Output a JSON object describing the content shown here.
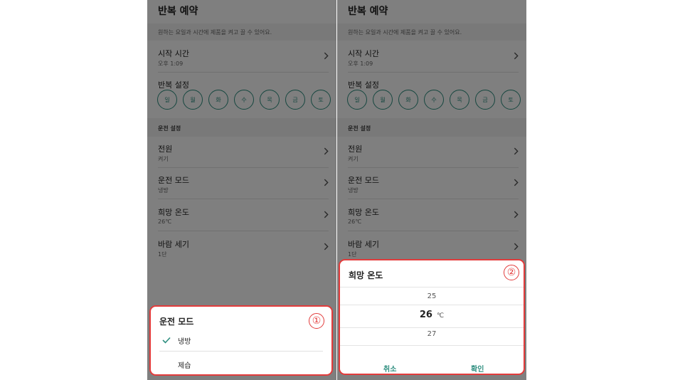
{
  "screens": [
    {
      "title": "반복 예약",
      "description": "원하는 요일과 시간에 제품을 켜고 끌 수 있어요.",
      "start_time": {
        "label": "시작 시간",
        "value": "오후 1:09"
      },
      "repeat": {
        "label": "반복 설정",
        "days": [
          "일",
          "월",
          "화",
          "수",
          "목",
          "금",
          "토"
        ]
      },
      "section_label": "운전 설정",
      "settings": [
        {
          "label": "전원",
          "value": "켜기"
        },
        {
          "label": "운전 모드",
          "value": "냉방"
        },
        {
          "label": "희망 온도",
          "value": "26℃"
        },
        {
          "label": "바람 세기",
          "value": "1단"
        }
      ]
    },
    {
      "title": "반복 예약",
      "description": "원하는 요일과 시간에 제품을 켜고 끌 수 있어요.",
      "start_time": {
        "label": "시작 시간",
        "value": "오후 1:09"
      },
      "repeat": {
        "label": "반복 설정",
        "days": [
          "일",
          "월",
          "화",
          "수",
          "목",
          "금",
          "토"
        ]
      },
      "section_label": "운전 설정",
      "settings": [
        {
          "label": "전원",
          "value": "켜기"
        },
        {
          "label": "운전 모드",
          "value": "냉방"
        },
        {
          "label": "희망 온도",
          "value": "26℃"
        },
        {
          "label": "바람 세기",
          "value": "1단"
        }
      ]
    }
  ],
  "mode_sheet": {
    "title": "운전 모드",
    "marker": "①",
    "options": [
      {
        "label": "냉방",
        "selected": true
      },
      {
        "label": "제습",
        "selected": false
      }
    ]
  },
  "temp_sheet": {
    "title": "희망 온도",
    "marker": "②",
    "prev_value": "25",
    "selected_value": "26",
    "unit": "℃",
    "next_value": "27",
    "cancel_label": "취소",
    "confirm_label": "확인"
  },
  "colors": {
    "accent": "#2f8f80",
    "highlight": "#e23b3b",
    "dim": "rgba(0,0,0,0.5)"
  },
  "icons": {
    "chevron": "chevron-right-icon",
    "check": "check-icon"
  }
}
